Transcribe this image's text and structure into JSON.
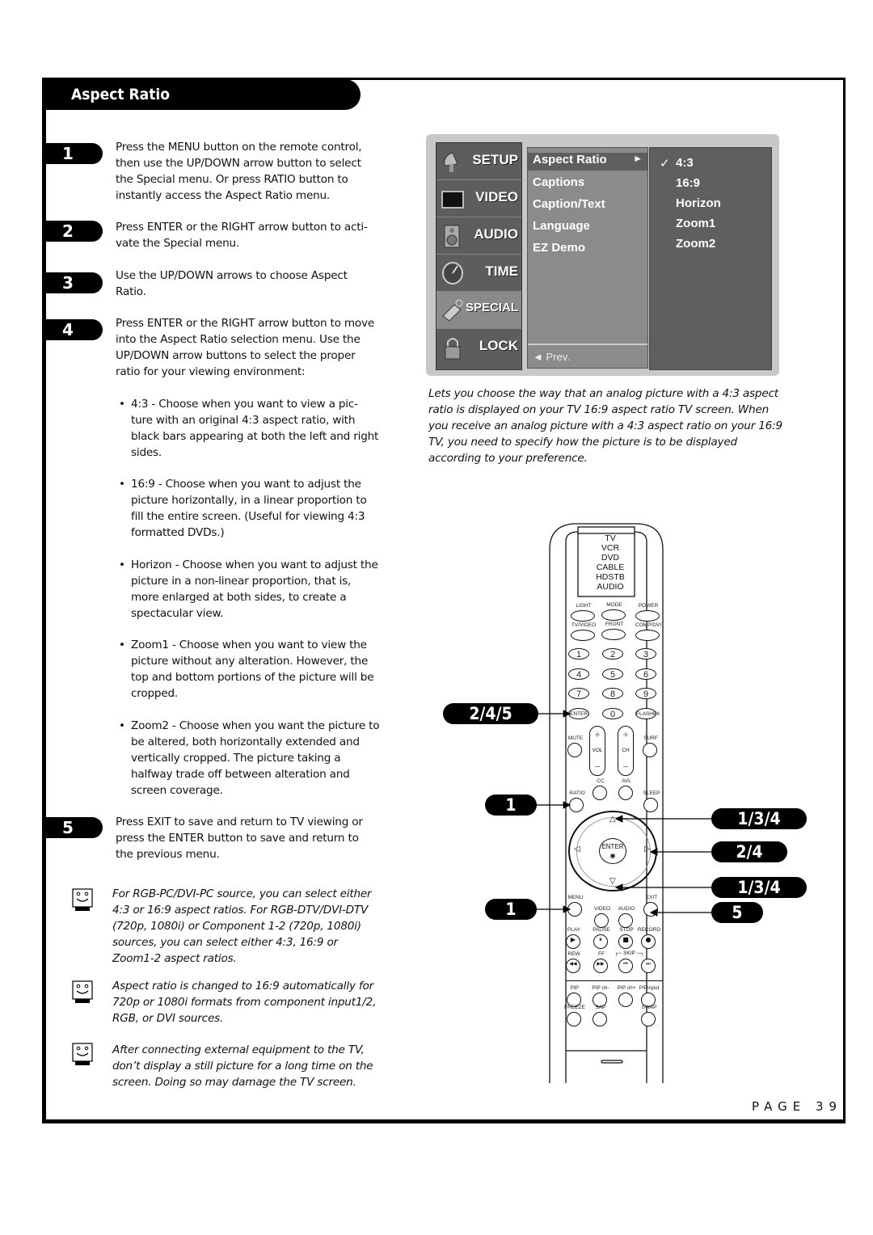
{
  "section_title": "Aspect Ratio",
  "steps": [
    {
      "number": "1",
      "text": "Press the MENU button on the remote control, then use the UP/DOWN arrow button to select the Special menu. Or press RATIO button to instantly access the Aspect Ratio menu."
    },
    {
      "number": "2",
      "text": "Press ENTER or the RIGHT arrow button to acti- vate the Special menu."
    },
    {
      "number": "3",
      "text": "Use the UP/DOWN arrows to choose Aspect Ratio."
    },
    {
      "number": "4",
      "text": "Press ENTER or the RIGHT arrow button to move into the Aspect Ratio selection menu. Use the UP/DOWN arrow buttons to select the proper ratio for your viewing environment:"
    },
    {
      "number": "5",
      "text": "Press EXIT to save and return to TV viewing or press the ENTER button to save and return to the previous menu."
    }
  ],
  "bullets": [
    {
      "symbol": "•",
      "text": "4:3 - Choose when you want to view a pic- ture with an original 4:3 aspect ratio, with black bars appearing at both the left and right sides."
    },
    {
      "symbol": "•",
      "text": "16:9 - Choose when you want to adjust the picture horizontally, in a linear proportion to fill the entire screen. (Useful for viewing 4:3 formatted DVDs.)"
    },
    {
      "symbol": "•",
      "text": "Horizon - Choose when you want to adjust the picture in a non-linear proportion, that is, more enlarged at both sides, to create a spectacular view."
    },
    {
      "symbol": "•",
      "text": "Zoom1 - Choose when you want to view the picture without any alteration. However, the top and bottom portions of the picture will be cropped."
    },
    {
      "symbol": "•",
      "text": "Zoom2 - Choose when you want the picture to be altered, both horizontally extended and vertically cropped. The picture taking a halfway trade off between alteration and screen coverage."
    }
  ],
  "notes": [
    {
      "icon": "tv-smiley-icon",
      "text": "For RGB-PC/DVI-PC source, you can select either 4:3 or 16:9 aspect ratios. For RGB-DTV/DVI-DTV (720p, 1080i) or Component 1-2 (720p, 1080i) sources, you can select either 4:3, 16:9 or Zoom1-2 aspect ratios."
    },
    {
      "icon": "tv-smiley-icon",
      "text": "Aspect ratio is changed to 16:9 automatically for 720p or 1080i formats from component input1/2, RGB, or DVI sources."
    },
    {
      "icon": "tv-smiley-icon",
      "text": "After connecting external equipment to the TV, don’t display a still picture for a long time on the screen. Doing so may damage the TV screen."
    }
  ],
  "osd_menu": {
    "tabs": [
      {
        "label": "SETUP",
        "icon": "satellite-dish-icon",
        "selected": false
      },
      {
        "label": "VIDEO",
        "icon": "tv-screen-icon",
        "selected": false
      },
      {
        "label": "AUDIO",
        "icon": "speaker-icon",
        "selected": false
      },
      {
        "label": "TIME",
        "icon": "clock-icon",
        "selected": false
      },
      {
        "label": "SPECIAL",
        "icon": "tag-icon",
        "selected": true
      },
      {
        "label": "LOCK",
        "icon": "padlock-icon",
        "selected": false
      }
    ],
    "items": [
      {
        "label": "Aspect Ratio",
        "arrow": "►",
        "selected": true
      },
      {
        "label": "Captions"
      },
      {
        "label": "Caption/Text"
      },
      {
        "label": "Language"
      },
      {
        "label": "EZ Demo"
      }
    ],
    "prev_label": "◄ Prev.",
    "options": [
      {
        "label": "4:3",
        "checked": true,
        "check": "✓"
      },
      {
        "label": "16:9"
      },
      {
        "label": "Horizon"
      },
      {
        "label": "Zoom1"
      },
      {
        "label": "Zoom2"
      }
    ]
  },
  "caption": "Lets you choose the way that an analog picture with a 4:3 aspect ratio is displayed on your TV 16:9 aspect ratio TV screen. When you receive an analog picture with a 4:3 aspect ratio on your 16:9 TV, you need to specify how the picture is to be displayed according to your preference.",
  "remote": {
    "modes": [
      "TV",
      "VCR",
      "DVD",
      "CABLE",
      "HDSTB",
      "AUDIO"
    ],
    "top_buttons": [
      "LIGHT",
      "MODE",
      "POWER",
      "TV/VIDEO",
      "FRONT",
      "COMP/DVI"
    ],
    "keypad": [
      "1",
      "2",
      "3",
      "4",
      "5",
      "6",
      "7",
      "8",
      "9",
      "ENTER",
      "0",
      "FLASHBK"
    ],
    "mute": "MUTE",
    "vol": "VOL",
    "ch": "CH",
    "surf": "SURF",
    "cc": "CC",
    "avl": "AVL",
    "ratio": "RATIO",
    "sleep": "SLEEP",
    "enter": "ENTER",
    "menu": "MENU",
    "exit": "EXIT",
    "video": "VIDEO",
    "audio": "AUDIO",
    "transport": [
      "PLAY",
      "PAUSE",
      "STOP",
      "RECORD",
      "REW",
      "FF"
    ],
    "skip": "SKIP",
    "pip_row": [
      "PIP",
      "PIP ch-",
      "PIP ch+",
      "PIPinput"
    ],
    "bottom_row": [
      "FREEZE",
      "SAP",
      "SWAP"
    ]
  },
  "callouts": {
    "left": [
      "2/4/5",
      "1",
      "1"
    ],
    "right": [
      "1/3/4",
      "2/4",
      "1/3/4",
      "5"
    ]
  },
  "page_label": "PAGE 39"
}
